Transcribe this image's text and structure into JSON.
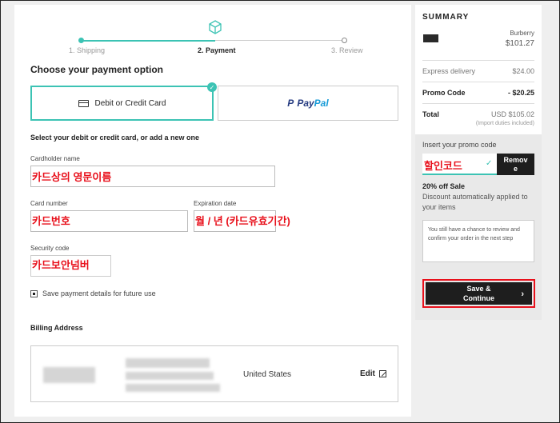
{
  "steps": [
    {
      "label": "1. Shipping",
      "state": "done"
    },
    {
      "label": "2. Payment",
      "state": "active"
    },
    {
      "label": "3. Review",
      "state": "todo"
    }
  ],
  "accent_color": "#3cc3b4",
  "highlight_color": "#e8101b",
  "payment": {
    "title": "Choose your payment option",
    "card_option_label": "Debit or Credit Card",
    "paypal_label_1": "Pay",
    "paypal_label_2": "Pal",
    "subhead": "Select your debit or credit card, or add a new one"
  },
  "form": {
    "cardholder_label": "Cardholder name",
    "cardholder_annotation": "카드상의 영문이름",
    "card_number_label": "Card number",
    "card_number_annotation": "카드번호",
    "expiration_label": "Expiration date",
    "expiration_annotation": "월 / 년 (카드유효기간)",
    "security_label": "Security code",
    "security_annotation": "카드보안넘버",
    "save_details_label": "Save payment details for future use"
  },
  "billing": {
    "title": "Billing Address",
    "country": "United States",
    "edit_label": "Edit"
  },
  "summary": {
    "title": "SUMMARY",
    "product_brand": "Burberry",
    "product_price": "$101.27",
    "delivery_label": "Express delivery",
    "delivery_value": "$24.00",
    "promo_label": "Promo Code",
    "promo_value": "- $20.25",
    "total_label": "Total",
    "total_value": "USD $105.02",
    "duties_note": "(Import duties included)"
  },
  "promo": {
    "label": "Insert your promo code",
    "annotation": "할인코드",
    "remove_label_1": "Remov",
    "remove_label_2": "e",
    "sale_title": "20% off Sale",
    "sale_desc": "Discount automatically applied to your items",
    "info_text": "You still have a chance to review and confirm your order in the next step"
  },
  "cta": {
    "line1": "Save &",
    "line2": "Continue"
  }
}
